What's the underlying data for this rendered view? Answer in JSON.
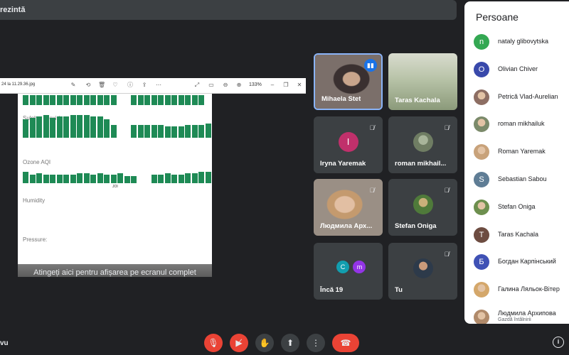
{
  "top_bar": {
    "title": "rezintă"
  },
  "presentation": {
    "file_name": "24 la 11.29.36.jpg",
    "zoom": "133%",
    "sections": [
      "Sulphur Dioxide",
      "Ozone AQI",
      "Humidity",
      "Pressure:"
    ],
    "day_label": "JOI",
    "overlay_text": "Atingeți aici pentru afișarea pe ecranul complet"
  },
  "tiles": [
    {
      "name": "Mihaela Stet",
      "active": true,
      "talking": true
    },
    {
      "name": "Taras Kachala"
    },
    {
      "name": "Iryna Yaremak",
      "initial": "I",
      "color": "#c0306b",
      "muted": true
    },
    {
      "name": "roman mikhail...",
      "muted": true
    },
    {
      "name": "Людмила Арх...",
      "muted": true
    },
    {
      "name": "Stefan Oniga",
      "muted": true
    },
    {
      "name": "Încă 19",
      "initials": [
        "C",
        "m"
      ],
      "colors": [
        "#129eaf",
        "#9334e6"
      ]
    },
    {
      "name": "Tu",
      "muted": true
    }
  ],
  "people_panel": {
    "title": "Persoane",
    "people": [
      {
        "name": "nataly glibovytska",
        "initial": "n",
        "color": "#34a853",
        "photo": false
      },
      {
        "name": "Olivian Chiver",
        "initial": "O",
        "color": "#3949ab",
        "photo": false
      },
      {
        "name": "Petrică Vlad-Aurelian",
        "initial": "",
        "color": "#8d6e63",
        "photo": true
      },
      {
        "name": "roman mikhailuk",
        "initial": "",
        "color": "#7b8a6a",
        "photo": true
      },
      {
        "name": "Roman Yaremak",
        "initial": "",
        "color": "#c8a27a",
        "photo": true
      },
      {
        "name": "Sebastian Sabou",
        "initial": "S",
        "color": "#5f7d95",
        "photo": false
      },
      {
        "name": "Stefan Oniga",
        "initial": "",
        "color": "#6d8f4e",
        "photo": true
      },
      {
        "name": "Taras Kachala",
        "initial": "T",
        "color": "#6d4c41",
        "photo": false
      },
      {
        "name": "Богдан Карпінський",
        "initial": "Б",
        "color": "#3f51b5",
        "photo": false
      },
      {
        "name": "Галина Ляльок-Вітер",
        "initial": "",
        "color": "#d4a76a",
        "photo": true
      },
      {
        "name": "Людмила Архипова",
        "subtitle": "Gazdă întâlnirii",
        "initial": "",
        "color": "#b08a6a",
        "photo": true
      }
    ]
  },
  "bottom_bar": {
    "left_text": "vu"
  }
}
